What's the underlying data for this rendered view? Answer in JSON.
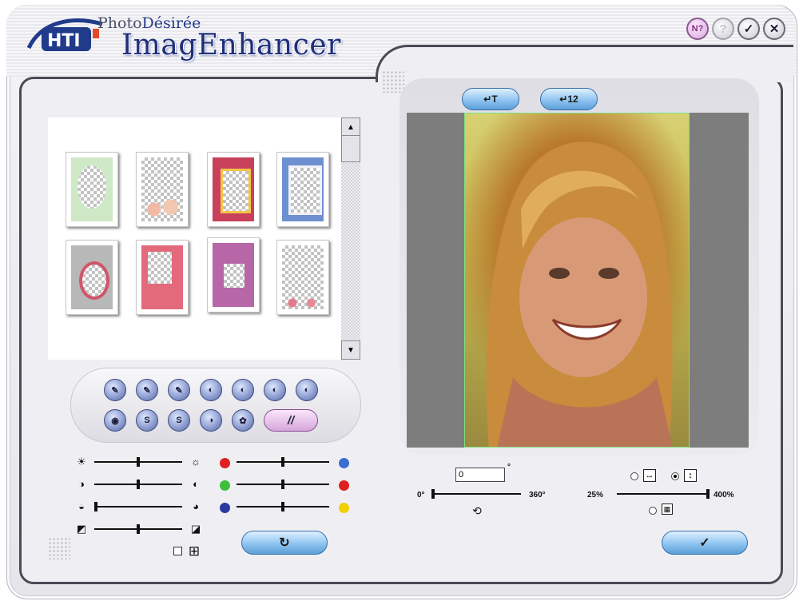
{
  "app": {
    "brand_small_prefix": "Photo",
    "brand_small_suffix": "Désirée",
    "brand_big": "ImagEnhancer",
    "logo_text": "HTI"
  },
  "title_buttons": [
    {
      "name": "help-pointer-button",
      "glyph": "N?"
    },
    {
      "name": "help-button",
      "glyph": "?"
    },
    {
      "name": "ok-title-button",
      "glyph": "✓"
    },
    {
      "name": "close-button",
      "glyph": "✕"
    }
  ],
  "preview_toolbar": {
    "button1_glyph": "↵T",
    "button2_glyph": "↵12"
  },
  "effects": {
    "row1": [
      "✎",
      "✎",
      "✎",
      "◐",
      "◐",
      "◐",
      "◐"
    ],
    "row2": [
      "◉",
      "S",
      "S",
      "◑",
      "✿"
    ],
    "wide_label": "//"
  },
  "adjust": {
    "brightness_value": 0.5,
    "contrast_value": 0.5,
    "gamma_value": 0.0,
    "sharp_value": 0.5,
    "red_cyan_value": 0.5,
    "green_magenta_value": 0.5,
    "yellow_blue_value": 0.5,
    "grid_checkbox_checked": false
  },
  "colors": {
    "red": "#e02020",
    "blue": "#3a6ed0",
    "green": "#3cc03c",
    "navy": "#2a3aa0",
    "yellow": "#f0d000"
  },
  "rotate": {
    "angle_value": "0",
    "degree_symbol": "°",
    "min_label": "0°",
    "max_label": "360°",
    "slider_value": 0
  },
  "zoom": {
    "min_label": "25%",
    "max_label": "400%",
    "slider_value": 1.0,
    "fit_width_selected": false,
    "fit_height_selected": true,
    "fit_page_selected": false
  },
  "reset_button_glyph": "↻",
  "ok_button_glyph": "✓"
}
